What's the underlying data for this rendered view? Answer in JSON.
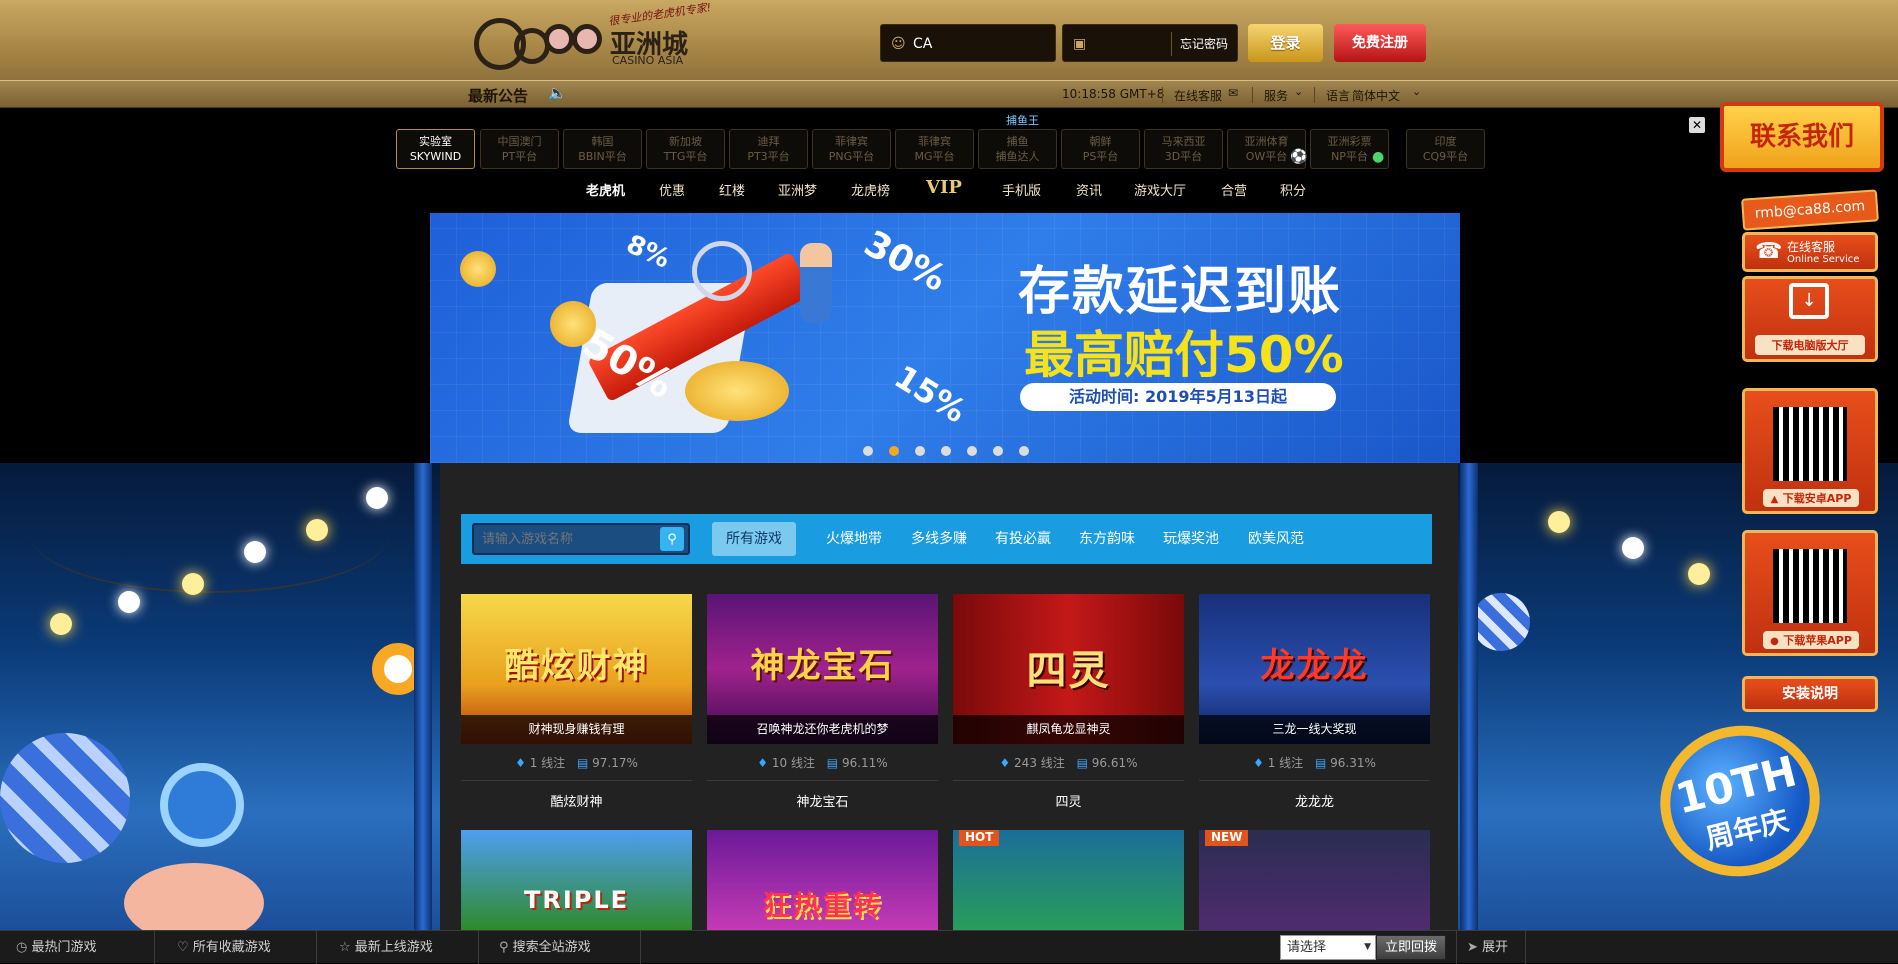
{
  "header": {
    "logo_text": "亚洲城",
    "logo_sub": "CASINO ASIA",
    "logo_slogan": "很专业的老虎机专家!",
    "username_value": "CA",
    "forgot_label": "忘记密码",
    "login_label": "登录",
    "register_label": "免费注册"
  },
  "notice": {
    "title": "最新公告",
    "time": "10:18:58 GMT+8",
    "support": "在线客服",
    "service": "服务",
    "language_label": "语言",
    "language_value": "简体中文"
  },
  "platforms": [
    {
      "top": "实验室",
      "bottom": "SKYWIND"
    },
    {
      "top": "中国澳门",
      "bottom": "PT平台"
    },
    {
      "top": "韩国",
      "bottom": "BBIN平台"
    },
    {
      "top": "新加坡",
      "bottom": "TTG平台"
    },
    {
      "top": "迪拜",
      "bottom": "PT3平台"
    },
    {
      "top": "菲律宾",
      "bottom": "PNG平台"
    },
    {
      "top": "菲律宾",
      "bottom": "MG平台"
    },
    {
      "top": "捕鱼",
      "bottom": "捕鱼达人"
    },
    {
      "top": "朝鲜",
      "bottom": "PS平台"
    },
    {
      "top": "马来西亚",
      "bottom": "3D平台"
    },
    {
      "top": "亚洲体育",
      "bottom": "OW平台"
    },
    {
      "top": "亚洲彩票",
      "bottom": "NP平台"
    },
    {
      "top": "印度",
      "bottom": "CQ9平台"
    }
  ],
  "fish_king": "捕鱼王",
  "nav": [
    "老虎机",
    "优惠",
    "红楼",
    "亚洲梦",
    "龙虎榜",
    "VIP",
    "手机版",
    "资讯",
    "游戏大厅",
    "合营",
    "积分"
  ],
  "banner": {
    "headline": "存款延迟到账",
    "subline": "最高赔付50%",
    "date": "活动时间: 2019年5月13日起",
    "pct_a": "8%",
    "pct_b": "30%",
    "pct_c": "50%",
    "pct_d": "15%"
  },
  "filter": {
    "search_placeholder": "请输入游戏名称",
    "tabs": [
      "所有游戏",
      "火爆地带",
      "多线多赚",
      "有投必赢",
      "东方韵味",
      "玩爆奖池",
      "欧美风范"
    ]
  },
  "games": [
    {
      "art": "酷炫财神",
      "caption": "财神现身赚钱有理",
      "lines": "1 线注",
      "rtp": "97.17%",
      "name": "酷炫财神"
    },
    {
      "art": "神龙宝石",
      "caption": "召唤神龙还你老虎机的梦",
      "lines": "10 线注",
      "rtp": "96.11%",
      "name": "神龙宝石"
    },
    {
      "art": "四灵",
      "caption": "麒凤龟龙显神灵",
      "lines": "243 线注",
      "rtp": "96.61%",
      "name": "四灵"
    },
    {
      "art": "龙龙龙",
      "caption": "三龙一线大奖现",
      "lines": "1 线注",
      "rtp": "96.31%",
      "name": "龙龙龙"
    }
  ],
  "games_row2": [
    {
      "art": "TRIPLE",
      "badge": ""
    },
    {
      "art": "狂热重转",
      "badge": ""
    },
    {
      "art": "",
      "badge": "HOT"
    },
    {
      "art": "",
      "badge": "NEW"
    }
  ],
  "right_panel": {
    "contact": "联系我们",
    "email": "rmb@ca88.com",
    "online_service": "在线客服",
    "online_service_en": "Online Service",
    "download_pc": "下载电脑版大厅",
    "download_android": "下载安卓APP",
    "download_ios": "下载苹果APP",
    "install_guide": "安装说明",
    "anniversary": "10TH",
    "anniversary_sub": "周年庆"
  },
  "bottom_bar": {
    "hot_games": "最热门游戏",
    "favorites": "所有收藏游戏",
    "new_games": "最新上线游戏",
    "search_all": "搜索全站游戏",
    "select_placeholder": "请选择",
    "back_button": "立即回拨",
    "expand": "展开"
  },
  "colors": {
    "gold": "#c9a862",
    "filter_blue": "#1a9de0",
    "accent_red": "#e84e1b"
  }
}
